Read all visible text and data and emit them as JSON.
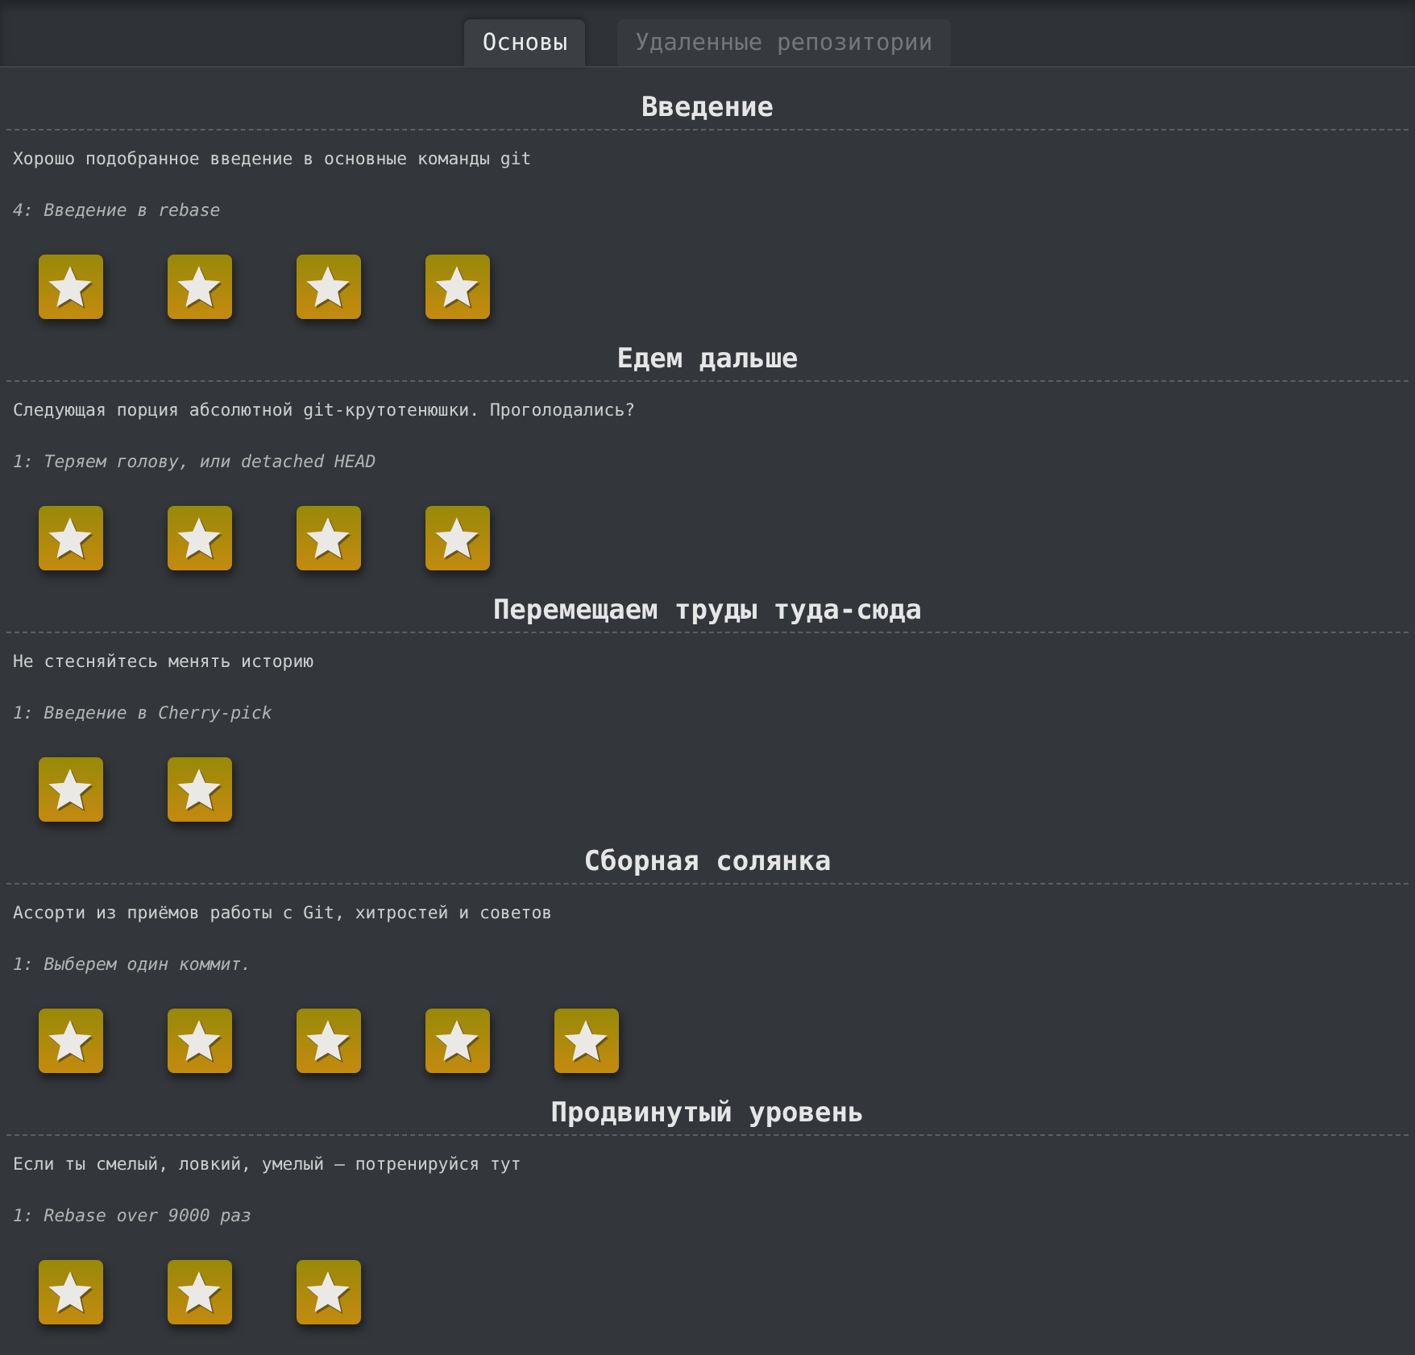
{
  "tabs": [
    {
      "label": "Основы",
      "selected": true
    },
    {
      "label": "Удаленные репозитории",
      "selected": false
    }
  ],
  "sections": [
    {
      "title": "Введение",
      "description": "Хорошо подобранное введение в основные команды git",
      "level_name": "4: Введение в rebase",
      "levels": [
        {
          "solved": true
        },
        {
          "solved": true
        },
        {
          "solved": true
        },
        {
          "solved": true
        }
      ]
    },
    {
      "title": "Едем дальше",
      "description": "Следующая порция абсолютной git-крутотенюшки. Проголодались?",
      "level_name": "1: Теряем голову, или detached HEAD",
      "levels": [
        {
          "solved": true
        },
        {
          "solved": true
        },
        {
          "solved": true
        },
        {
          "solved": true
        }
      ]
    },
    {
      "title": "Перемещаем труды туда-сюда",
      "description": "Не стесняйтесь менять историю",
      "level_name": "1: Введение в Cherry-pick",
      "levels": [
        {
          "solved": true
        },
        {
          "solved": true
        }
      ]
    },
    {
      "title": "Сборная солянка",
      "description": "Ассорти из приёмов работы с Git, хитростей и советов",
      "level_name": "1: Выберем один коммит.",
      "levels": [
        {
          "solved": true
        },
        {
          "solved": true
        },
        {
          "solved": true
        },
        {
          "solved": true
        },
        {
          "solved": true
        }
      ]
    },
    {
      "title": "Продвинутый уровень",
      "description": "Если ты смелый, ловкий, умелый – потренируйся тут",
      "level_name": "1: Rebase over 9000 раз",
      "levels": [
        {
          "solved": true
        },
        {
          "solved": true
        },
        {
          "solved": true
        }
      ]
    }
  ]
}
